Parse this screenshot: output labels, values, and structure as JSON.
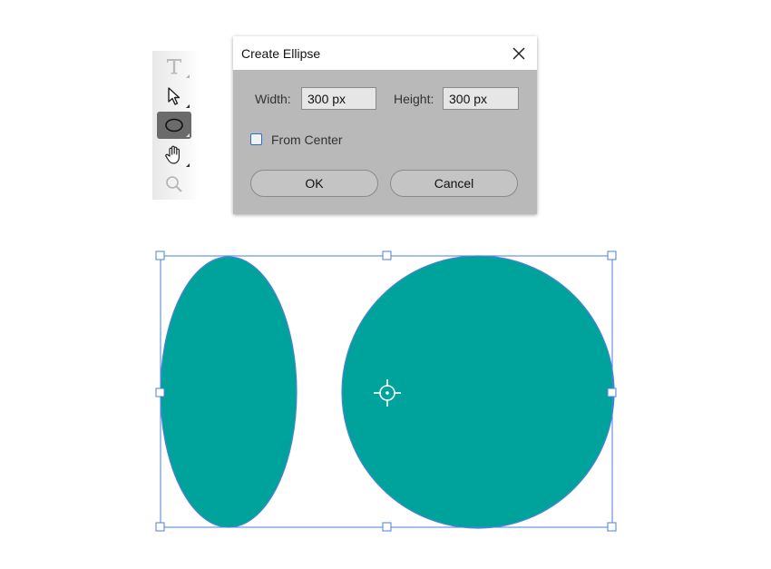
{
  "dialog": {
    "title": "Create Ellipse",
    "width_label": "Width:",
    "width_value": "300 px",
    "height_label": "Height:",
    "height_value": "300 px",
    "from_center_label": "From Center",
    "from_center_checked": false,
    "ok_label": "OK",
    "cancel_label": "Cancel"
  },
  "toolbar": {
    "tools": [
      "type-tool",
      "selection-tool",
      "ellipse-tool",
      "hand-tool",
      "zoom-tool"
    ],
    "active_tool": "ellipse-tool"
  },
  "canvas": {
    "shape_fill": "#00a39c",
    "selection_color": "#4a82d6",
    "shapes": [
      "ellipse",
      "circle"
    ]
  }
}
